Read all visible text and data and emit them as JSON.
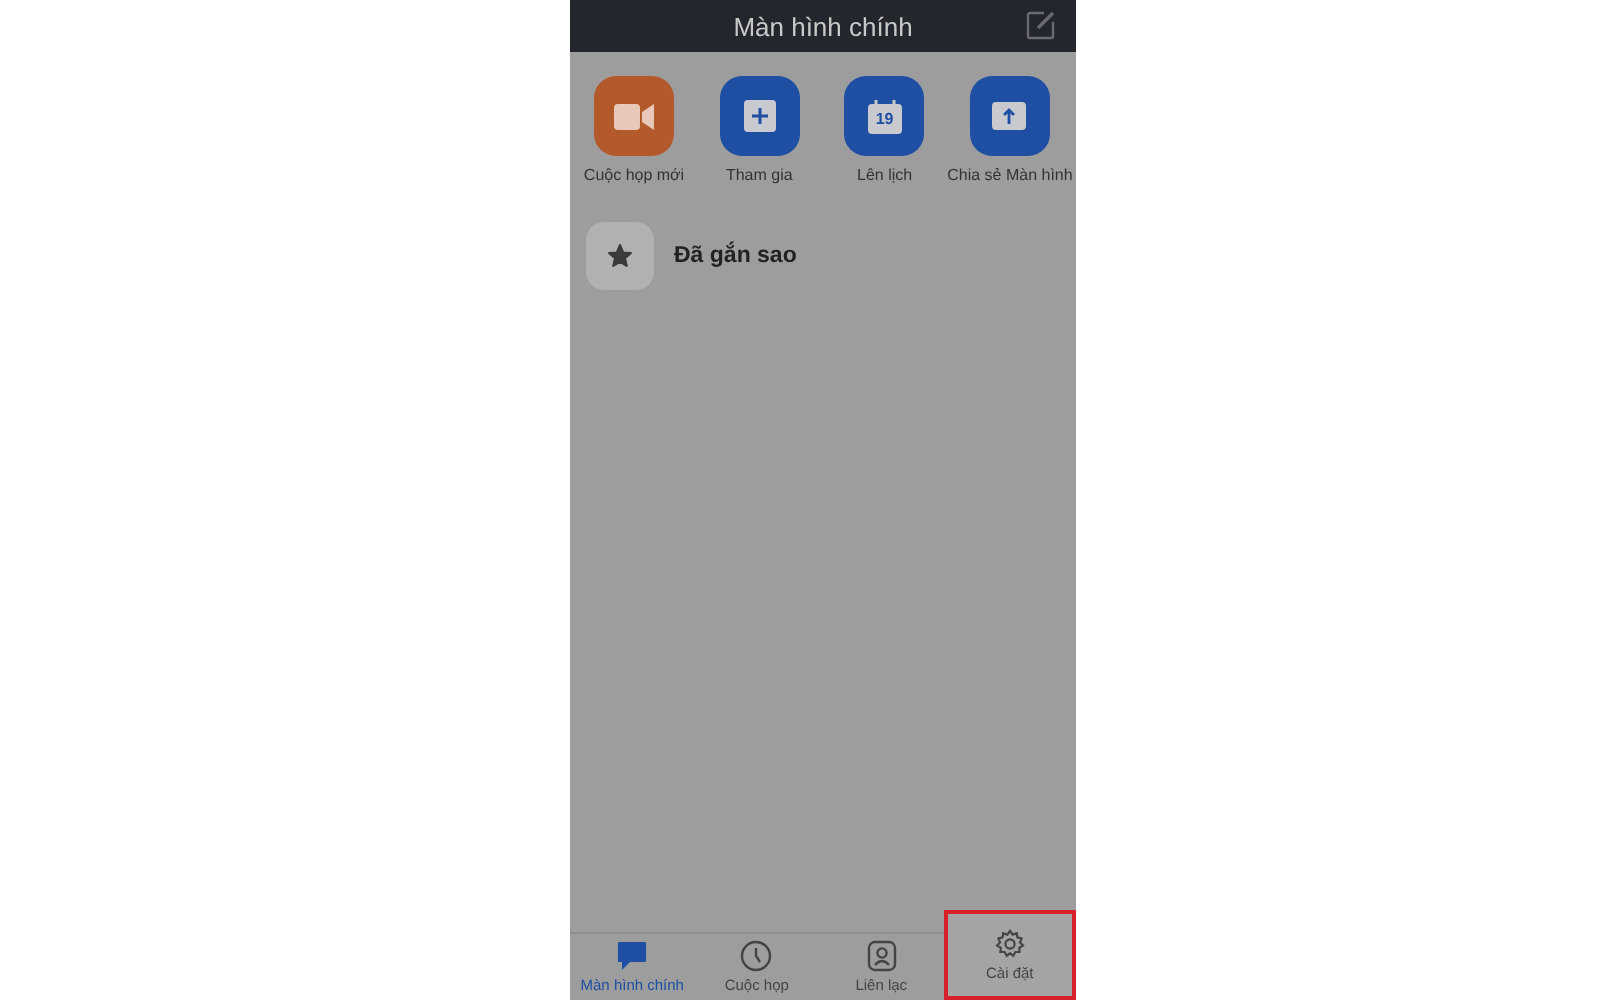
{
  "header": {
    "title": "Màn hình chính"
  },
  "actions": [
    {
      "label": "Cuộc họp mới",
      "kind": "video",
      "color": "#b4592b"
    },
    {
      "label": "Tham gia",
      "kind": "plus",
      "color": "#1f4fa3"
    },
    {
      "label": "Lên lịch",
      "kind": "calendar",
      "color": "#1f4fa3",
      "icon_text": "19"
    },
    {
      "label": "Chia sẻ Màn hình",
      "kind": "share",
      "color": "#1f4fa3"
    }
  ],
  "starred": {
    "label": "Đã gắn sao"
  },
  "tabs": [
    {
      "label": "Màn hình chính",
      "kind": "chat",
      "selected": true,
      "highlighted": false
    },
    {
      "label": "Cuộc họp",
      "kind": "clock",
      "selected": false,
      "highlighted": false
    },
    {
      "label": "Liên lạc",
      "kind": "contact",
      "selected": false,
      "highlighted": false
    },
    {
      "label": "Cài đặt",
      "kind": "gear",
      "selected": false,
      "highlighted": true
    }
  ]
}
